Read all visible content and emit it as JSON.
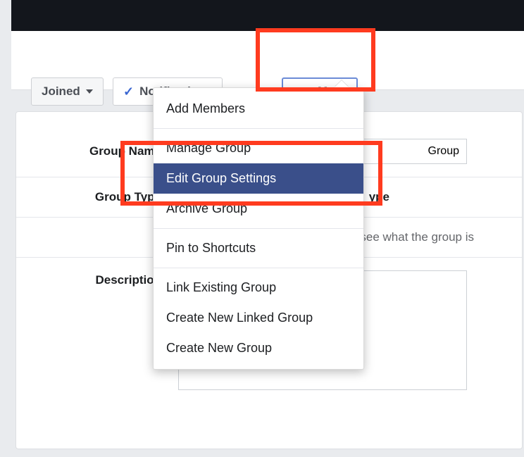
{
  "toolbar": {
    "joined_label": "Joined",
    "notifications_label": "Notifications",
    "more_label": "More"
  },
  "menu": {
    "items": [
      {
        "label": "Add Members",
        "selected": false
      },
      {
        "sep": true
      },
      {
        "label": "Manage Group",
        "selected": false
      },
      {
        "label": "Edit Group Settings",
        "selected": true
      },
      {
        "label": "Archive Group",
        "selected": false
      },
      {
        "sep": true
      },
      {
        "label": "Pin to Shortcuts",
        "selected": false
      },
      {
        "sep": true
      },
      {
        "label": "Link Existing Group",
        "selected": false
      },
      {
        "label": "Create New Linked Group",
        "selected": false
      },
      {
        "label": "Create New Group",
        "selected": false
      }
    ]
  },
  "form": {
    "group_name_label": "Group Name",
    "group_name_value_suffix": "Group",
    "group_type_label": "Group Type",
    "group_type_value_suffix": "ype",
    "description_label": "Description",
    "description_hint_suffix": " see what the group is"
  }
}
